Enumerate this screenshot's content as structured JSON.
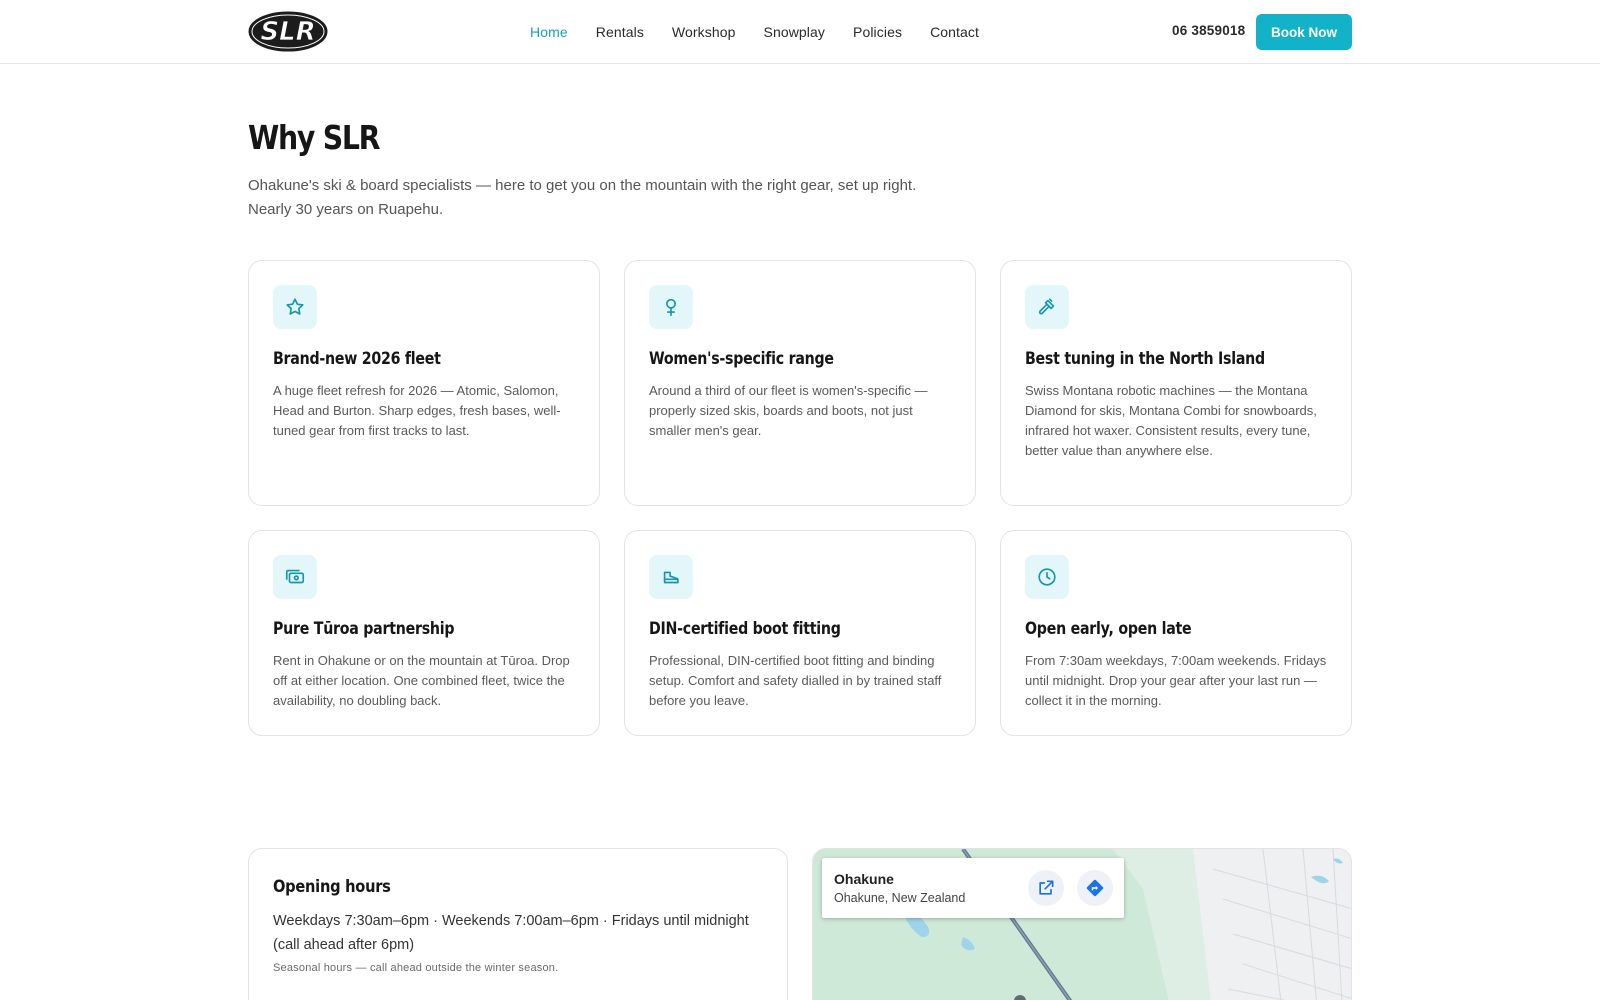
{
  "header": {
    "logo_text": "SLR",
    "nav": [
      {
        "label": "Home",
        "active": true
      },
      {
        "label": "Rentals",
        "active": false
      },
      {
        "label": "Workshop",
        "active": false
      },
      {
        "label": "Snowplay",
        "active": false
      },
      {
        "label": "Policies",
        "active": false
      },
      {
        "label": "Contact",
        "active": false
      }
    ],
    "phone": "06 3859018",
    "cta_label": "Book Now"
  },
  "intro": {
    "title": "Why SLR",
    "subtitle_line1": "Ohakune's ski & board specialists — here to get you on the mountain with the right gear, set up right.",
    "subtitle_line2": "Nearly 30 years on Ruapehu."
  },
  "features": [
    {
      "icon": "star-icon",
      "title": "Brand-new 2026 fleet",
      "text": "A huge fleet refresh for 2026 — Atomic, Salomon, Head and Burton. Sharp edges, fresh bases, well-tuned gear from first tracks to last."
    },
    {
      "icon": "female-symbol-icon",
      "title": "Women's-specific range",
      "text": "Around a third of our fleet is women's-specific — properly sized skis, boards and boots, not just smaller men's gear."
    },
    {
      "icon": "hammer-icon",
      "title": "Best tuning in the North Island",
      "text": "Swiss Montana robotic machines — the Montana Diamond for skis, Montana Combi for snowboards, infrared hot waxer. Consistent results, every tune, better value than anywhere else."
    },
    {
      "icon": "cash-icon",
      "title": "Pure Tūroa partnership",
      "text": "Rent in Ohakune or on the mountain at Tūroa. Drop off at either location. One combined fleet, twice the availability, no doubling back."
    },
    {
      "icon": "boot-icon",
      "title": "DIN-certified boot fitting",
      "text": "Professional, DIN-certified boot fitting and binding setup. Comfort and safety dialled in by trained staff before you leave."
    },
    {
      "icon": "clock-icon",
      "title": "Open early, open late",
      "text": "From 7:30am weekdays, 7:00am weekends. Fridays until midnight. Drop your gear after your last run — collect it in the morning."
    }
  ],
  "hours": {
    "title": "Opening hours",
    "text": "Weekdays 7:30am–6pm · Weekends 7:00am–6pm · Fridays until midnight (call ahead after 6pm)",
    "note": "Seasonal hours — call ahead outside the winter season."
  },
  "map": {
    "place": "Ohakune",
    "address": "Ohakune, New Zealand",
    "open_icon": "external-link-icon",
    "directions_icon": "directions-icon"
  },
  "colors": {
    "accent": "#12b3c9",
    "accent_light": "#e3f7fa",
    "nav_active": "#16a3b4"
  }
}
